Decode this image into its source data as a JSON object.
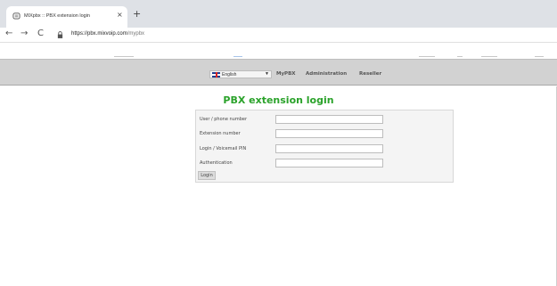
{
  "browser": {
    "tab_title": "MIXpbx :: PBX extension login",
    "tab_close": "×",
    "new_tab": "+",
    "url_host": "https://pbx.mixvoip.com",
    "url_path": "/mypbx",
    "back": "←",
    "forward": "→",
    "reload": "C"
  },
  "header": {
    "language": "English",
    "nav": [
      "MyPBX",
      "Administration",
      "Reseller"
    ]
  },
  "main": {
    "title": "PBX extension login",
    "fields": [
      {
        "label": "User / phone number",
        "value": ""
      },
      {
        "label": "Extension number",
        "value": ""
      },
      {
        "label": "Login / Voicemail PIN",
        "value": ""
      },
      {
        "label": "Authentication",
        "value": ""
      }
    ],
    "submit_label": "Login"
  },
  "colors": {
    "title_green": "#2aa22a",
    "header_bg": "#d2d2d2"
  }
}
